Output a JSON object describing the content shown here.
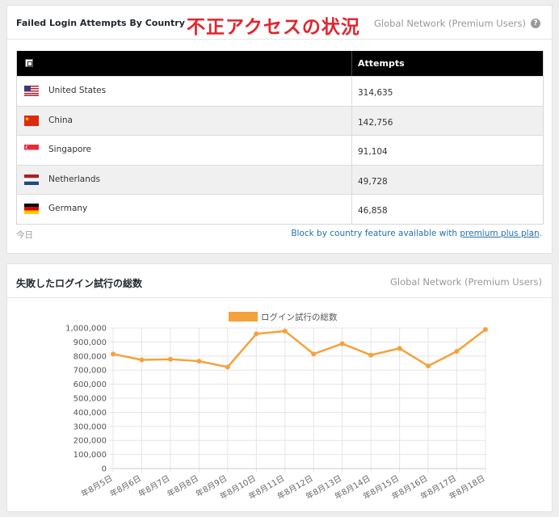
{
  "panel1": {
    "title": "Failed Login Attempts By Country",
    "jp_title": "不正アクセスの状況",
    "right_label": "Global Network (Premium Users)",
    "help_icon": "?",
    "table": {
      "header_attempts": "Attempts",
      "rows": [
        {
          "country": "United States",
          "flag": "us-flag",
          "attempts": "314,635"
        },
        {
          "country": "China",
          "flag": "cn-flag",
          "attempts": "142,756"
        },
        {
          "country": "Singapore",
          "flag": "sg-flag",
          "attempts": "91,104"
        },
        {
          "country": "Netherlands",
          "flag": "nl-flag",
          "attempts": "49,728"
        },
        {
          "country": "Germany",
          "flag": "de-flag",
          "attempts": "46,858"
        }
      ]
    },
    "today": "今日",
    "block_text": "Block by country feature available with ",
    "block_link": "premium plus plan",
    "block_end": "."
  },
  "panel2": {
    "title": "失敗したログイン試行の総数",
    "right_label": "Global Network (Premium Users)"
  },
  "chart_data": {
    "type": "line",
    "legend": "ログイン試行の総数",
    "color": "#f4a23c",
    "categories": [
      "年8月5日",
      "年8月6日",
      "年8月7日",
      "年8月8日",
      "年8月9日",
      "年8月10日",
      "年8月11日",
      "年8月12日",
      "年8月13日",
      "年8月14日",
      "年8月15日",
      "年8月16日",
      "年8月17日",
      "年8月18日"
    ],
    "series": [
      {
        "name": "ログイン試行の総数",
        "values": [
          815000,
          773000,
          777000,
          764000,
          722000,
          958000,
          978000,
          815000,
          888000,
          807000,
          855000,
          730000,
          834000,
          989000
        ]
      }
    ],
    "ylim": [
      0,
      1000000
    ],
    "yticks": [
      "0",
      "100,000",
      "200,000",
      "300,000",
      "400,000",
      "500,000",
      "600,000",
      "700,000",
      "800,000",
      "900,000",
      "1,000,000"
    ],
    "grid": true,
    "legend_position": "top"
  }
}
